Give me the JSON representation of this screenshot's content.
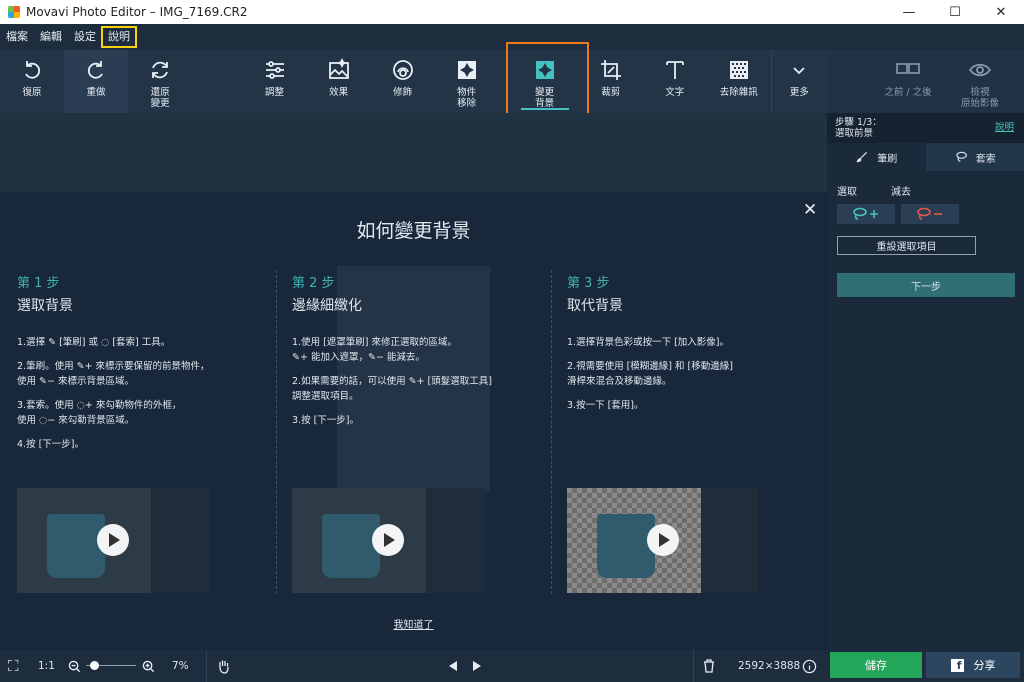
{
  "window": {
    "title": "Movavi Photo Editor – IMG_7169.CR2",
    "minimize": "—",
    "maximize": "☐",
    "close": "✕"
  },
  "menu": [
    "檔案",
    "編輯",
    "設定",
    "說明"
  ],
  "toolbar": {
    "undo": "復原",
    "redo": "重做",
    "restore": "還原\n變更",
    "adjust": "調整",
    "effects": "效果",
    "retouch": "修飾",
    "object_removal": "物件\n移除",
    "change_bg": "變更\n背景",
    "crop": "裁剪",
    "text": "文字",
    "denoise": "去除雜訊",
    "more": "更多",
    "before_after": "之前 / 之後",
    "view_original": "檢視\n原始影像"
  },
  "panel": {
    "step": "步驟 1/3：",
    "step_name": "選取前景",
    "help": "說明",
    "tab_brush": "筆刷",
    "tab_lasso": "套索",
    "select": "選取",
    "subtract": "減去",
    "reset": "重設選取項目",
    "next": "下一步"
  },
  "howto": {
    "title": "如何變更背景",
    "close": "✕",
    "got_it": "我知道了",
    "steps": [
      {
        "num": "第 1 步",
        "title": "選取背景",
        "items": [
          "1.選擇 ✎ [筆刷] 或 ◌ [套索] 工具。",
          "2.筆刷。使用 ✎+ 來標示要保留的前景物件，\n使用 ✎− 來標示背景區域。",
          "3.套索。使用 ◌+ 來勾勒物件的外框，\n使用 ◌− 來勾勒背景區域。",
          "4.按 [下一步]。"
        ]
      },
      {
        "num": "第 2 步",
        "title": "邊緣細緻化",
        "items": [
          "1.使用 [遮罩筆刷] 來修正選取的區域。\n✎+ 能加入遮罩，✎− 能減去。",
          "2.如果需要的話，可以使用 ✎+ [頭髮選取工具]\n調整選取項目。",
          "3.按 [下一步]。"
        ]
      },
      {
        "num": "第 3 步",
        "title": "取代背景",
        "items": [
          "1.選擇背景色彩或按一下 [加入影像]。",
          "2.視需要使用 [模糊邊緣] 和 [移動邊緣]\n滑桿來混合及移動邊緣。",
          "3.按一下 [套用]。"
        ]
      }
    ]
  },
  "status": {
    "fit": "⛶",
    "ratio": "1:1",
    "zoom": "7%",
    "dimensions": "2592×3888",
    "zoom_level": 0.1,
    "save": "儲存",
    "share": "分享"
  },
  "colors": {
    "accent": "#46c1c1",
    "highlight_orange": "#f07a1a",
    "highlight_yellow": "#f4d20b",
    "save_green": "#23a55a"
  }
}
